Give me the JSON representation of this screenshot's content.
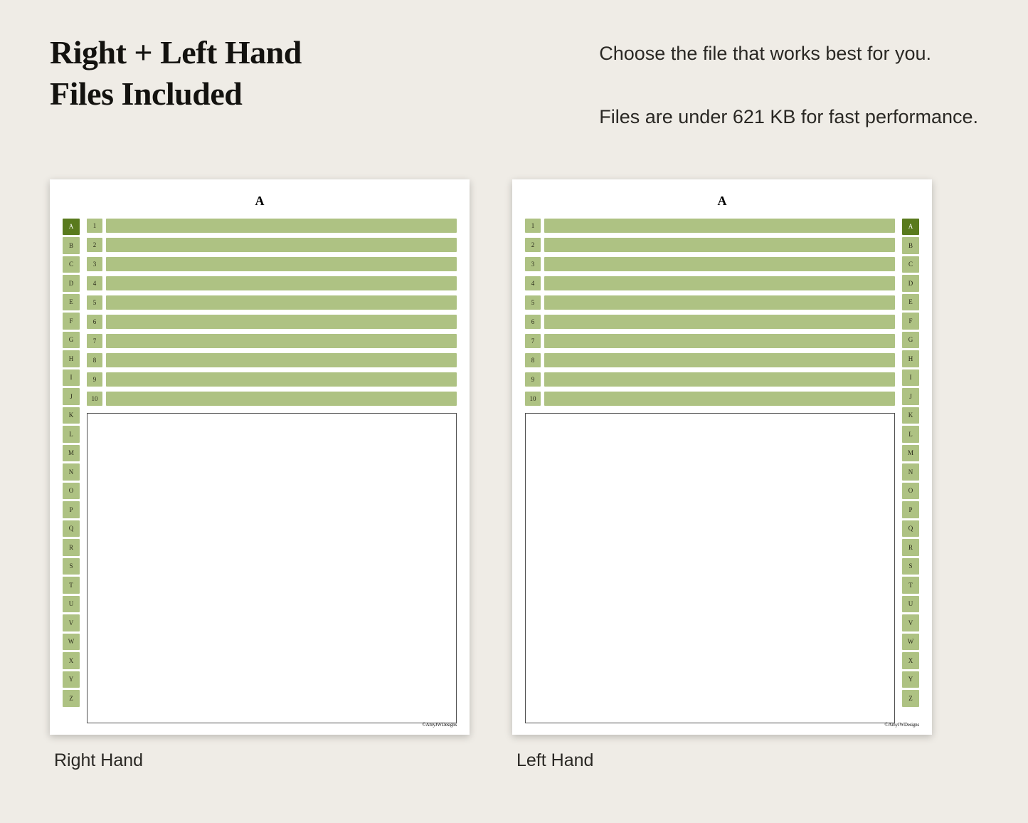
{
  "header": {
    "title_line1": "Right + Left Hand",
    "title_line2": "Files Included",
    "desc_line1": "Choose the file that works best for you.",
    "desc_line2": "Files are under 621 KB for fast performance."
  },
  "tabs": [
    "A",
    "B",
    "C",
    "D",
    "E",
    "F",
    "G",
    "H",
    "I",
    "J",
    "K",
    "L",
    "M",
    "N",
    "O",
    "P",
    "Q",
    "R",
    "S",
    "T",
    "U",
    "V",
    "W",
    "X",
    "Y",
    "Z"
  ],
  "active_tab": "A",
  "rows": [
    "1",
    "2",
    "3",
    "4",
    "5",
    "6",
    "7",
    "8",
    "9",
    "10"
  ],
  "page_letter": "A",
  "brand": "©AmyJWDesigns",
  "captions": {
    "right": "Right Hand",
    "left": "Left Hand"
  }
}
